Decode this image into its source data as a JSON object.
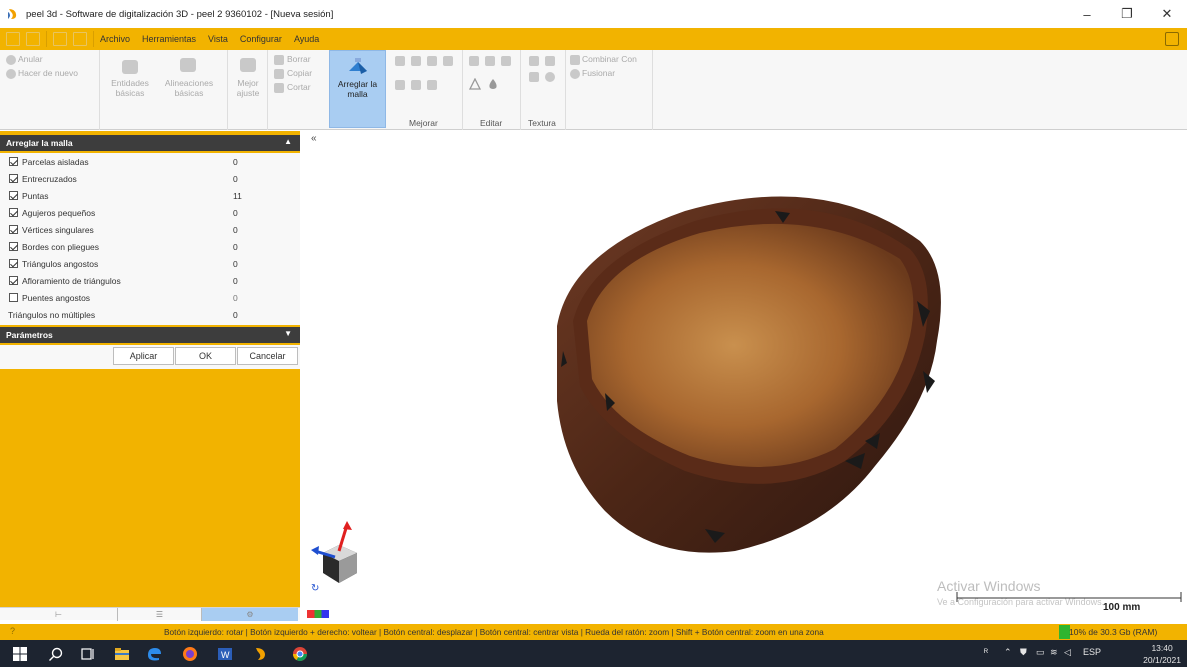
{
  "window": {
    "title": "peel 3d - Software de digitalización 3D - peel 2 9360102 - [Nueva sesión]",
    "controls": [
      "–",
      "❐",
      "✕"
    ]
  },
  "menu": {
    "items": [
      "Archivo",
      "Herramientas",
      "Vista",
      "Configurar",
      "Ayuda"
    ]
  },
  "ribbon": {
    "undo": "Anular",
    "redo": "Hacer de nuevo",
    "entities": [
      "Entidades",
      "básicas"
    ],
    "alignments": [
      "Alineaciones",
      "básicas"
    ],
    "best_fit": [
      "Mejor",
      "ajuste"
    ],
    "delete": "Borrar",
    "copy": "Copiar",
    "cut": "Cortar",
    "fix_mesh": [
      "Arreglar la",
      "malla"
    ],
    "combine": "Combinar Con",
    "merge": "Fusionar",
    "tabs": [
      "Mejorar",
      "Editar",
      "Textura"
    ]
  },
  "panel": {
    "title": "Arreglar la malla",
    "checks": [
      {
        "label": "Parcelas aisladas",
        "count": "0",
        "checked": true
      },
      {
        "label": "Entrecruzados",
        "count": "0",
        "checked": true
      },
      {
        "label": "Puntas",
        "count": "11",
        "checked": true
      },
      {
        "label": "Agujeros pequeños",
        "count": "0",
        "checked": true
      },
      {
        "label": "Vértices singulares",
        "count": "0",
        "checked": true
      },
      {
        "label": "Bordes con pliegues",
        "count": "0",
        "checked": true
      },
      {
        "label": "Triángulos angostos",
        "count": "0",
        "checked": true
      },
      {
        "label": "Afloramiento de triángulos",
        "count": "0",
        "checked": true
      },
      {
        "label": "Puentes angostos",
        "count": "0",
        "checked": false
      }
    ],
    "nonmanifold": {
      "label": "Triángulos no múltiples",
      "count": "0"
    },
    "params_title": "Parámetros",
    "apply": "Aplicar",
    "ok": "OK",
    "cancel": "Cancelar"
  },
  "viewport": {
    "activate_title": "Activar Windows",
    "activate_sub": "Ve a Configuración para activar Windows.",
    "scale": "100 mm"
  },
  "status": {
    "help": "?",
    "hints": "Botón izquierdo: rotar  |  Botón izquierdo + derecho: voltear  |  Botón central: desplazar  |  Botón central: centrar vista  |  Rueda del ratón: zoom  |  Shift + Botón central: zoom en una zona",
    "memory": "10% de 30.3 Gb (RAM)",
    "memory_fraction": 0.1
  },
  "taskbar": {
    "lang": "ESP",
    "time": "13:40",
    "date": "20/1/2021"
  },
  "colors": {
    "accent": "#f2b300",
    "panel_header": "#3d3d3d",
    "active_tool": "#a9cdf2",
    "taskbar": "#1d2430",
    "memory_bar": "#2fb52f"
  }
}
